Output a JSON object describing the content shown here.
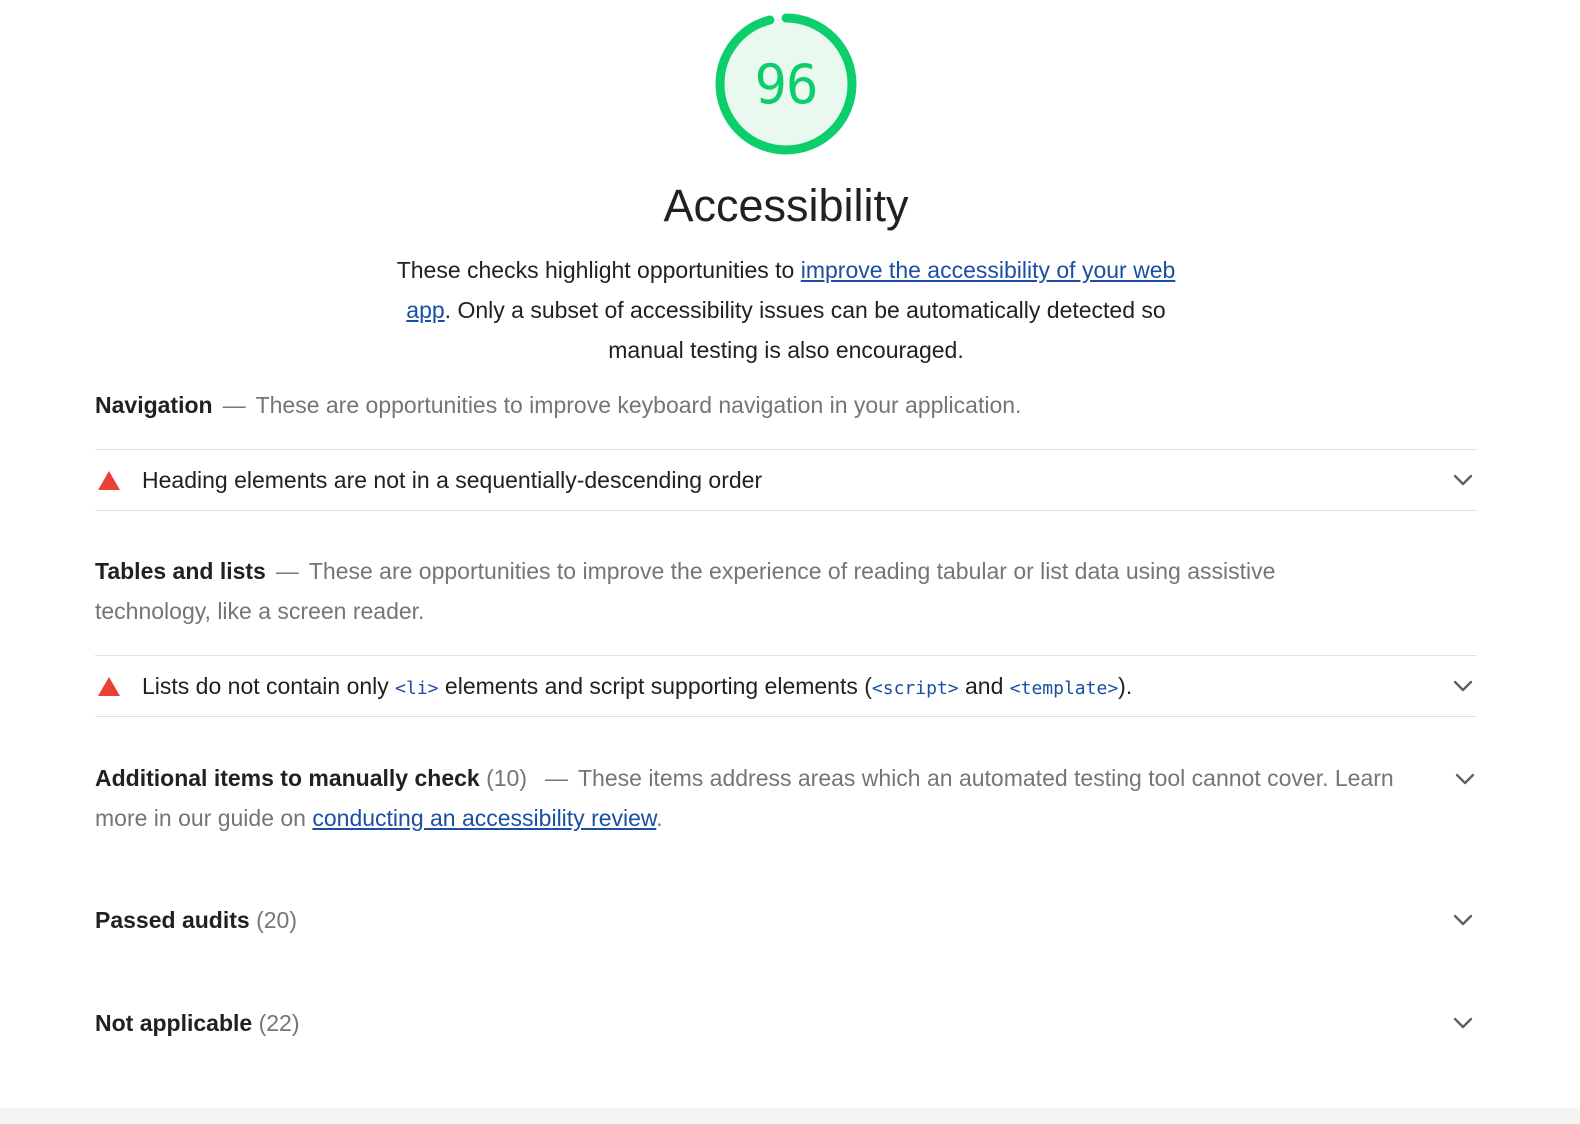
{
  "gauge": {
    "score": "96",
    "score_fraction": 0.96,
    "color": "#0cce6b",
    "fill_color": "#eaf9f0",
    "title": "Accessibility"
  },
  "description": {
    "text_before": "These checks highlight opportunities to ",
    "link_text": "improve the accessibility of your web app",
    "text_after": ". Only a subset of accessibility issues can be automatically detected so manual testing is also encouraged."
  },
  "groups": {
    "navigation": {
      "title": "Navigation",
      "separator": "—",
      "description": "These are opportunities to improve keyboard navigation in your application.",
      "audit": {
        "title": "Heading elements are not in a sequentially-descending order",
        "status_icon": "fail-triangle-icon"
      }
    },
    "tables_lists": {
      "title": "Tables and lists",
      "separator": "—",
      "description": "These are opportunities to improve the experience of reading tabular or list data using assistive technology, like a screen reader.",
      "audit": {
        "part1": "Lists do not contain only ",
        "code1": "<li>",
        "part2": " elements and script supporting elements (",
        "code2": "<script>",
        "part3": " and ",
        "code3": "<template>",
        "part4": ").",
        "status_icon": "fail-triangle-icon"
      }
    },
    "manual": {
      "title": "Additional items to manually check",
      "count": "(10)",
      "separator": "—",
      "description": "These items address areas which an automated testing tool cannot cover. Learn more in our guide on ",
      "link_text": "conducting an accessibility review",
      "suffix": "."
    },
    "passed": {
      "title": "Passed audits",
      "count": "(20)"
    },
    "not_applicable": {
      "title": "Not applicable",
      "count": "(22)"
    }
  },
  "colors": {
    "fail": "#eb4034",
    "link": "#1a4fa3",
    "pass": "#0cce6b"
  }
}
